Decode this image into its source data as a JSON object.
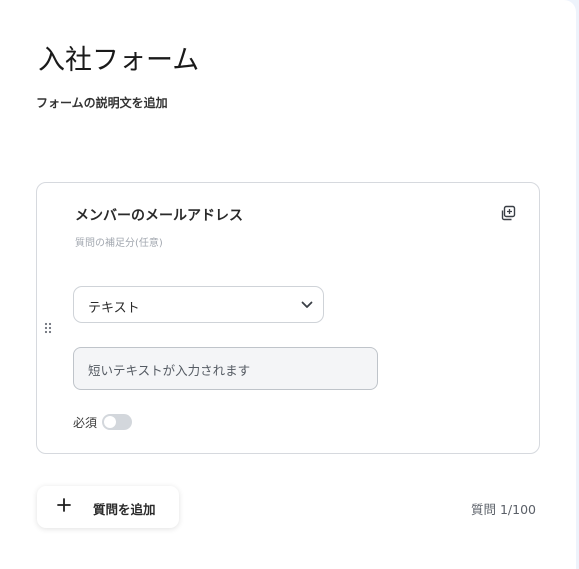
{
  "form": {
    "title": "入社フォーム",
    "description": "フォームの説明文を追加"
  },
  "question": {
    "title": "メンバーのメールアドレス",
    "help_text": "質問の補足分(任意)",
    "type_select": {
      "selected": "テキスト"
    },
    "answer_placeholder": "短いテキストが入力されます",
    "required_label": "必須",
    "required": false
  },
  "footer": {
    "add_question_label": "質問を追加",
    "question_count": "質問 1/100"
  },
  "icons": {
    "drag": "drag-handle-icon",
    "copy": "copy-icon",
    "chevron": "chevron-down-icon",
    "plus": "plus-icon"
  },
  "colors": {
    "border": "#d6d9de",
    "toggle_off": "#d3d7dc",
    "muted_text": "#a3a8b0"
  }
}
